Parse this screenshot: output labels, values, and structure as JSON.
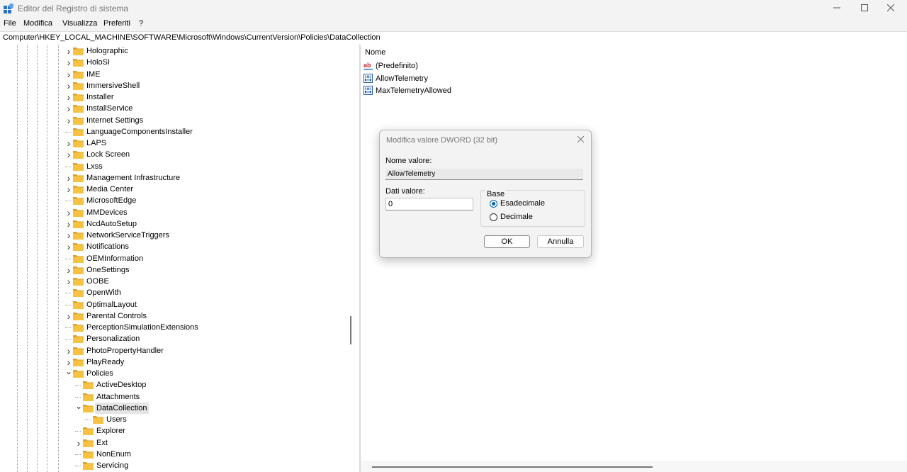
{
  "window": {
    "title": "Editor del Registro di sistema"
  },
  "menu": [
    "File",
    "Modifica",
    "Visualizza",
    "Preferiti",
    "?"
  ],
  "address": "Computer\\HKEY_LOCAL_MACHINE\\SOFTWARE\\Microsoft\\Windows\\CurrentVersion\\Policies\\DataCollection",
  "tree": [
    {
      "label": "Holographic",
      "level": 0,
      "expander": "collapsed"
    },
    {
      "label": "HoloSI",
      "level": 0,
      "expander": "collapsed"
    },
    {
      "label": "IME",
      "level": 0,
      "expander": "collapsed"
    },
    {
      "label": "ImmersiveShell",
      "level": 0,
      "expander": "collapsed"
    },
    {
      "label": "Installer",
      "level": 0,
      "expander": "collapsed"
    },
    {
      "label": "InstallService",
      "level": 0,
      "expander": "collapsed"
    },
    {
      "label": "Internet Settings",
      "level": 0,
      "expander": "collapsed"
    },
    {
      "label": "LanguageComponentsInstaller",
      "level": 0,
      "expander": "none"
    },
    {
      "label": "LAPS",
      "level": 0,
      "expander": "collapsed"
    },
    {
      "label": "Lock Screen",
      "level": 0,
      "expander": "collapsed"
    },
    {
      "label": "Lxss",
      "level": 0,
      "expander": "none"
    },
    {
      "label": "Management Infrastructure",
      "level": 0,
      "expander": "collapsed"
    },
    {
      "label": "Media Center",
      "level": 0,
      "expander": "collapsed"
    },
    {
      "label": "MicrosoftEdge",
      "level": 0,
      "expander": "none"
    },
    {
      "label": "MMDevices",
      "level": 0,
      "expander": "collapsed"
    },
    {
      "label": "NcdAutoSetup",
      "level": 0,
      "expander": "collapsed"
    },
    {
      "label": "NetworkServiceTriggers",
      "level": 0,
      "expander": "collapsed"
    },
    {
      "label": "Notifications",
      "level": 0,
      "expander": "collapsed"
    },
    {
      "label": "OEMInformation",
      "level": 0,
      "expander": "none"
    },
    {
      "label": "OneSettings",
      "level": 0,
      "expander": "collapsed"
    },
    {
      "label": "OOBE",
      "level": 0,
      "expander": "collapsed"
    },
    {
      "label": "OpenWith",
      "level": 0,
      "expander": "none"
    },
    {
      "label": "OptimalLayout",
      "level": 0,
      "expander": "none"
    },
    {
      "label": "Parental Controls",
      "level": 0,
      "expander": "collapsed"
    },
    {
      "label": "PerceptionSimulationExtensions",
      "level": 0,
      "expander": "none"
    },
    {
      "label": "Personalization",
      "level": 0,
      "expander": "none"
    },
    {
      "label": "PhotoPropertyHandler",
      "level": 0,
      "expander": "collapsed"
    },
    {
      "label": "PlayReady",
      "level": 0,
      "expander": "collapsed"
    },
    {
      "label": "Policies",
      "level": 0,
      "expander": "expanded"
    },
    {
      "label": "ActiveDesktop",
      "level": 1,
      "expander": "none"
    },
    {
      "label": "Attachments",
      "level": 1,
      "expander": "none"
    },
    {
      "label": "DataCollection",
      "level": 1,
      "expander": "expanded",
      "selected": true
    },
    {
      "label": "Users",
      "level": 2,
      "expander": "none"
    },
    {
      "label": "Explorer",
      "level": 1,
      "expander": "none"
    },
    {
      "label": "Ext",
      "level": 1,
      "expander": "collapsed"
    },
    {
      "label": "NonEnum",
      "level": 1,
      "expander": "none"
    },
    {
      "label": "Servicing",
      "level": 1,
      "expander": "none"
    }
  ],
  "values_pane": {
    "column_name": "Nome",
    "items": [
      {
        "name": "(Predefinito)",
        "icon": "string-value-icon"
      },
      {
        "name": "AllowTelemetry",
        "icon": "dword-value-icon"
      },
      {
        "name": "MaxTelemetryAllowed",
        "icon": "dword-value-icon"
      }
    ]
  },
  "dialog": {
    "title": "Modifica valore DWORD (32 bit)",
    "value_name_label": "Nome valore:",
    "value_name": "AllowTelemetry",
    "value_data_label": "Dati valore:",
    "value_data": "0",
    "base_label": "Base",
    "base_options": [
      {
        "label": "Esadecimale",
        "checked": true
      },
      {
        "label": "Decimale",
        "checked": false
      }
    ],
    "ok_label": "OK",
    "cancel_label": "Annulla"
  },
  "colors": {
    "folder": "#f5c242",
    "folder_dark": "#dba22c",
    "accent": "#005fb8"
  }
}
